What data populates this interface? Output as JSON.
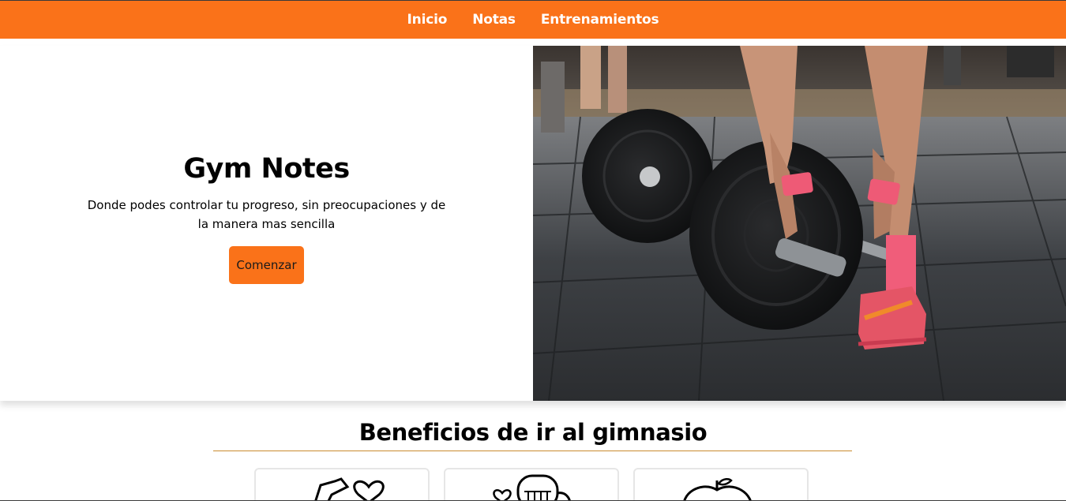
{
  "nav": {
    "items": [
      {
        "label": "Inicio"
      },
      {
        "label": "Notas"
      },
      {
        "label": "Entrenamientos"
      }
    ]
  },
  "hero": {
    "title": "Gym Notes",
    "description": "Donde podes controlar tu progreso, sin preocupaciones y de la manera mas sencilla",
    "cta_label": "Comenzar",
    "image_subject": "barbell-deadlift-photo"
  },
  "benefits": {
    "title": "Beneficios de ir al gimnasio",
    "cards": [
      {
        "icon": "flexed-arm-heart-icon"
      },
      {
        "icon": "heart-lungs-icon"
      },
      {
        "icon": "apple-icon"
      }
    ]
  },
  "colors": {
    "accent": "#fa7219",
    "divider": "#c98a2e"
  }
}
